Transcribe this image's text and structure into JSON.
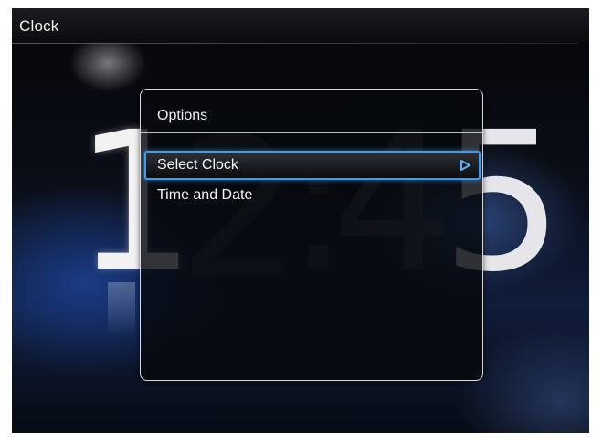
{
  "screen": {
    "title": "Clock"
  },
  "background_clock": {
    "digits": [
      "1",
      "2",
      ":",
      "4",
      "5"
    ]
  },
  "dialog": {
    "title": "Options",
    "items": [
      {
        "label": "Select Clock",
        "selected": true,
        "icon": "play-arrow-icon"
      },
      {
        "label": "Time and Date",
        "selected": false
      }
    ]
  },
  "colors": {
    "selection_accent": "#3d9cf0",
    "dialog_border": "#d8d8d8"
  }
}
